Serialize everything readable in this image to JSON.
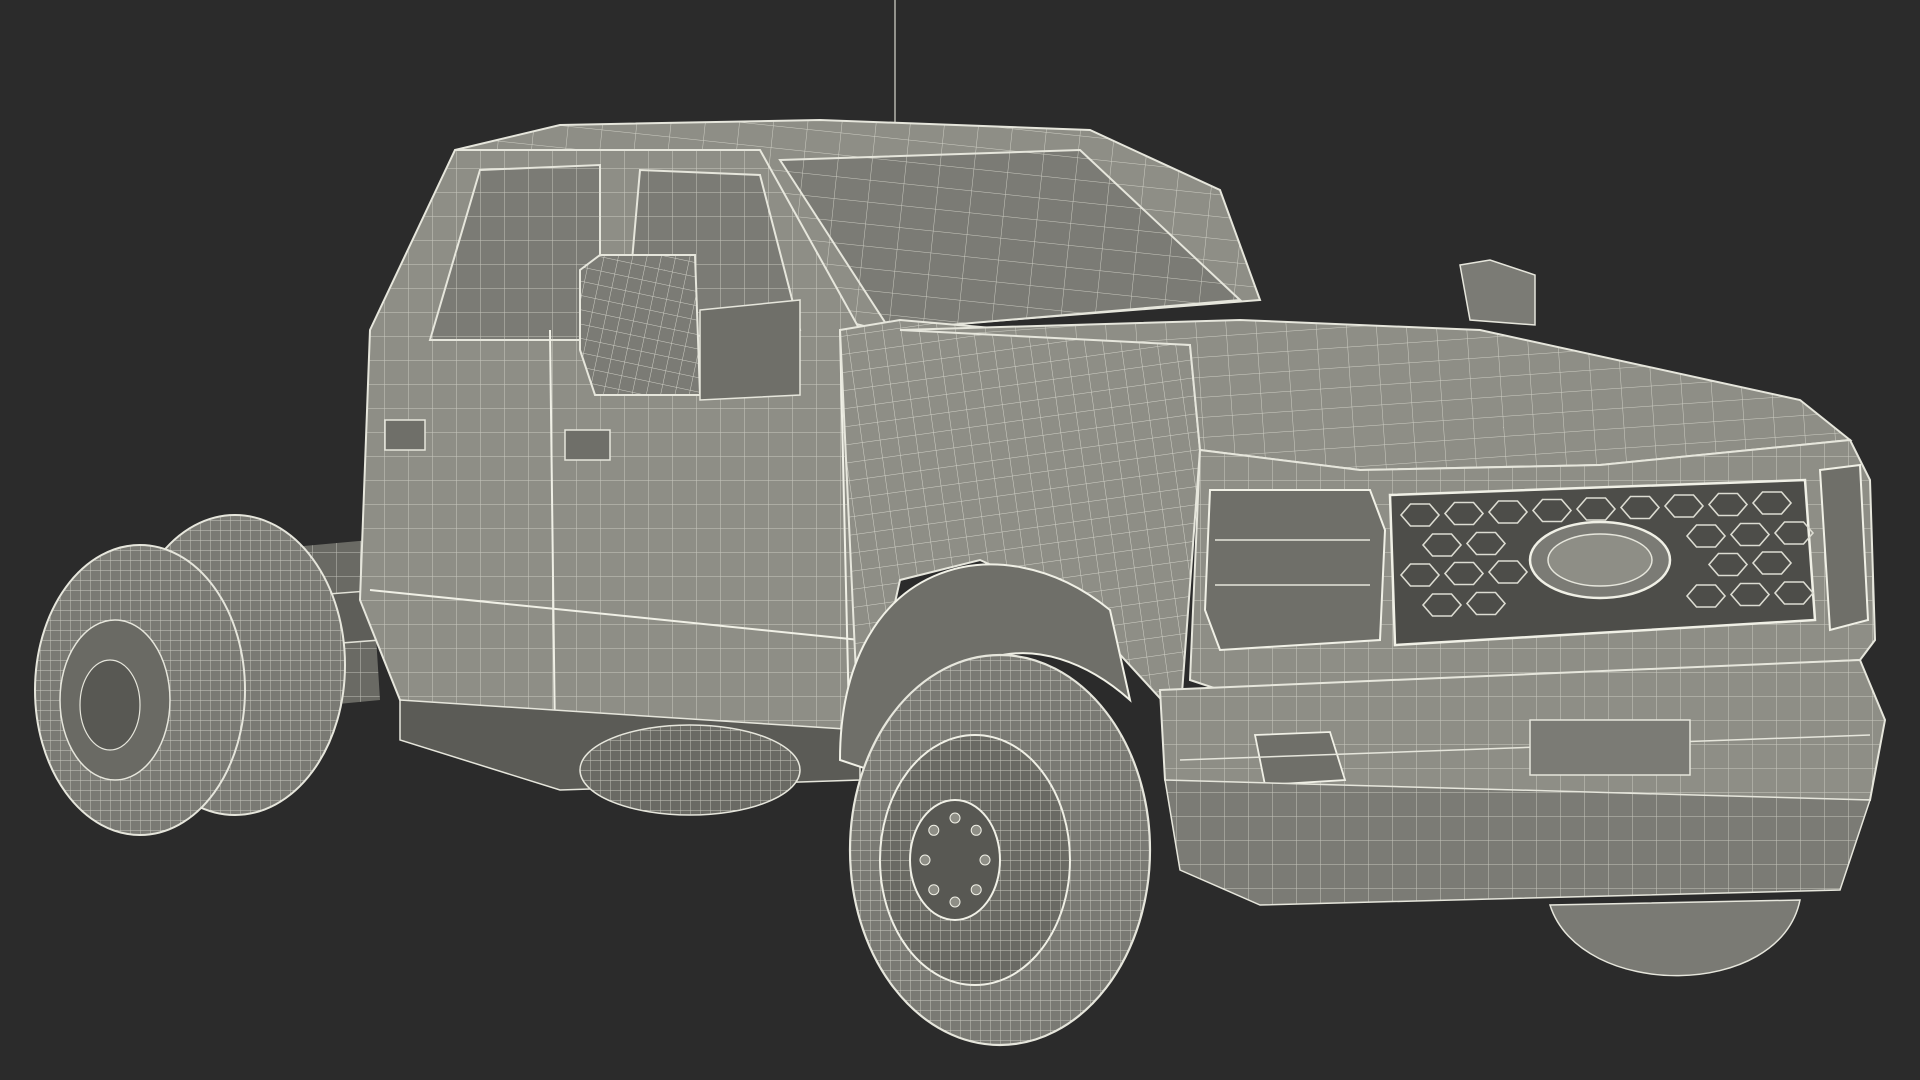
{
  "scene": {
    "background": "#2b2b2b",
    "subject": "truck-wireframe",
    "colors": {
      "body": "#8e8e86",
      "body_dark": "#6f6f69",
      "body_shadow": "#5b5b56",
      "glass": "#7b7b75",
      "wire": "#e6e6dc",
      "wire_minor": "#cfcfc5",
      "tire": "#7a7a74",
      "tire_dark": "#585853",
      "grille": "#4d4d49",
      "chassis": "#6a6a64"
    }
  }
}
